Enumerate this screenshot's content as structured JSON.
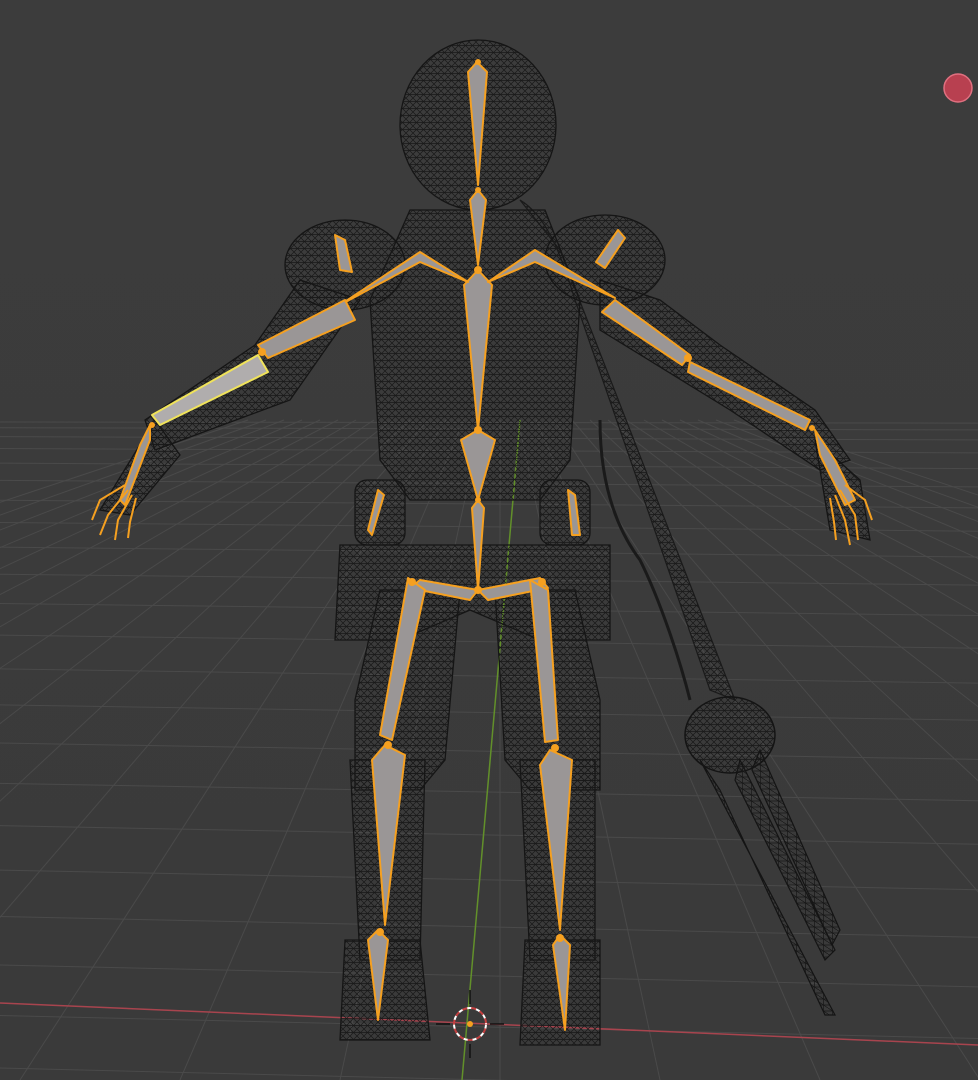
{
  "app": {
    "name": "3D Viewport",
    "mode": "wireframe",
    "shading": "wireframe-with-xray"
  },
  "scene": {
    "objects": [
      {
        "name": "character-mesh",
        "type": "mesh",
        "display": "wireframe",
        "color": "#1a1a1a"
      },
      {
        "name": "armature",
        "type": "armature",
        "display": "octahedral",
        "selected_color": "#f5a020",
        "active_color": "#f0e35a"
      },
      {
        "name": "spear-weapon",
        "type": "mesh",
        "display": "wireframe",
        "color": "#1a1a1a"
      }
    ],
    "floor_grid": true,
    "axis_x_color": "#b34a55",
    "axis_y_color": "#6a9a2a",
    "background": "#3d3d3d"
  },
  "overlay": {
    "record_indicator_color": "#c44050",
    "cursor_3d": "3d-cursor-icon"
  }
}
